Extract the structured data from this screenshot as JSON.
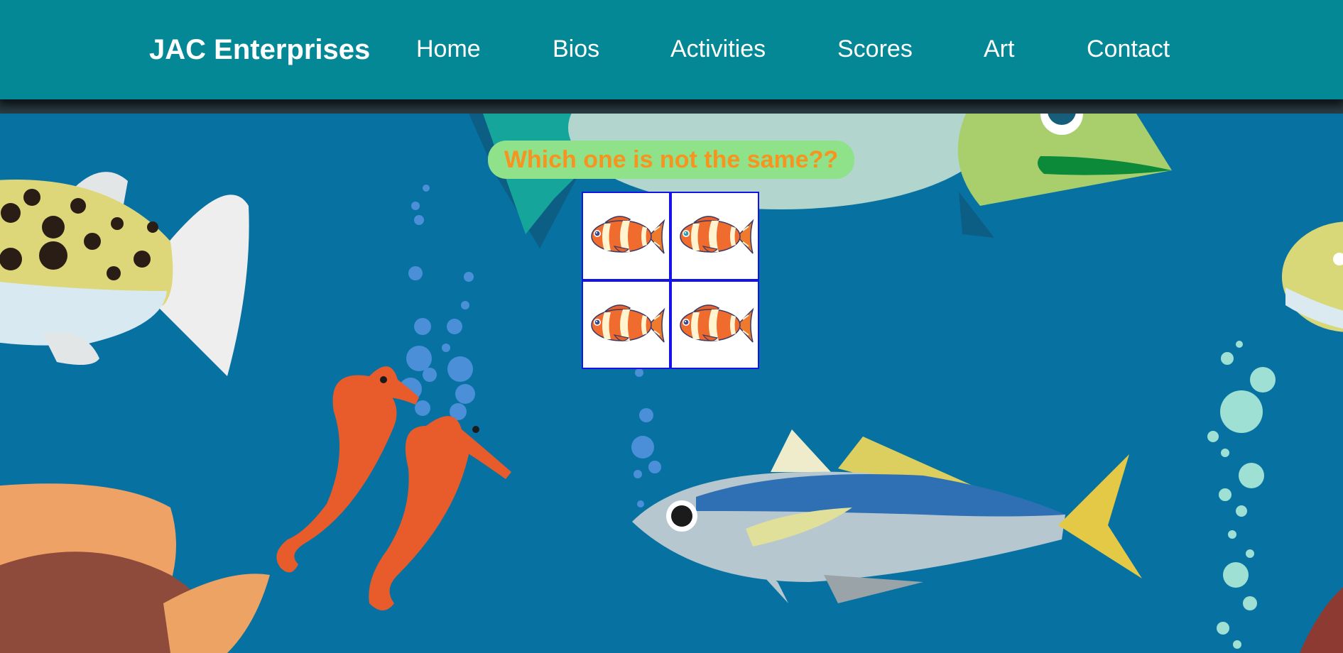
{
  "brand": {
    "name": "JAC Enterprises"
  },
  "nav": {
    "items": [
      {
        "label": "Home"
      },
      {
        "label": "Bios"
      },
      {
        "label": "Activities"
      },
      {
        "label": "Scores"
      },
      {
        "label": "Art"
      },
      {
        "label": "Contact"
      }
    ]
  },
  "game": {
    "question": "Which one is not the same??",
    "tiles": [
      {
        "icon": "clownfish-icon",
        "eye_color": "#3a4a8a"
      },
      {
        "icon": "clownfish-icon",
        "eye_color": "#2f9fb0"
      },
      {
        "icon": "clownfish-icon",
        "eye_color": "#3a4a8a"
      },
      {
        "icon": "clownfish-icon",
        "eye_color": "#3a4a8a"
      }
    ]
  },
  "colors": {
    "nav_bg": "#058895",
    "ocean_bg": "#0772a1",
    "question_bg": "#8fe28a",
    "question_text": "#f7931e",
    "grid_border": "#1414e6"
  }
}
